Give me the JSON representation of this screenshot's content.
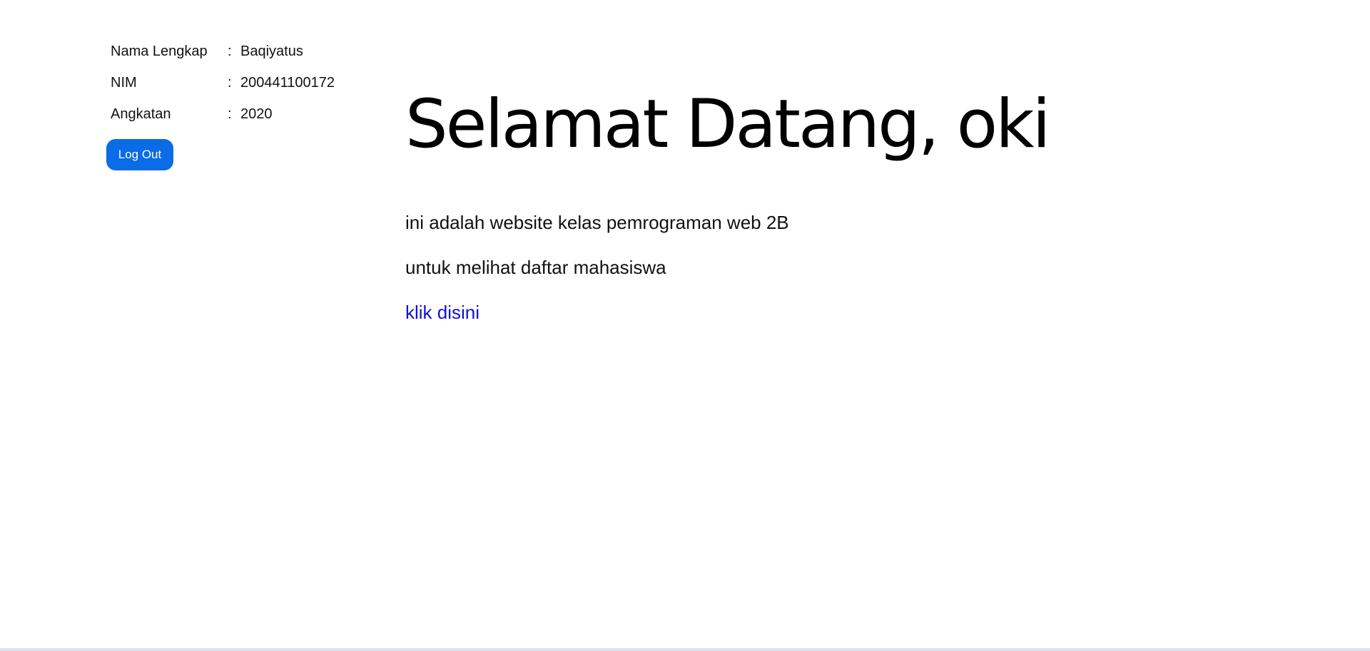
{
  "profile": {
    "rows": [
      {
        "label": "Nama Lengkap",
        "separator": ":",
        "value": "Baqiyatus"
      },
      {
        "label": "NIM",
        "separator": ":",
        "value": "200441100172"
      },
      {
        "label": "Angkatan",
        "separator": ":",
        "value": "2020"
      }
    ],
    "logout_label": "Log Out"
  },
  "main": {
    "title": "Selamat Datang, oki",
    "intro_line_1": "ini adalah website kelas pemrograman web 2B",
    "intro_line_2": "untuk melihat daftar mahasiswa",
    "link_label": "klik disini"
  },
  "colors": {
    "button_bg": "#0a6ce6",
    "button_text": "#ffffff",
    "link": "#1010d6",
    "text": "#000000"
  }
}
